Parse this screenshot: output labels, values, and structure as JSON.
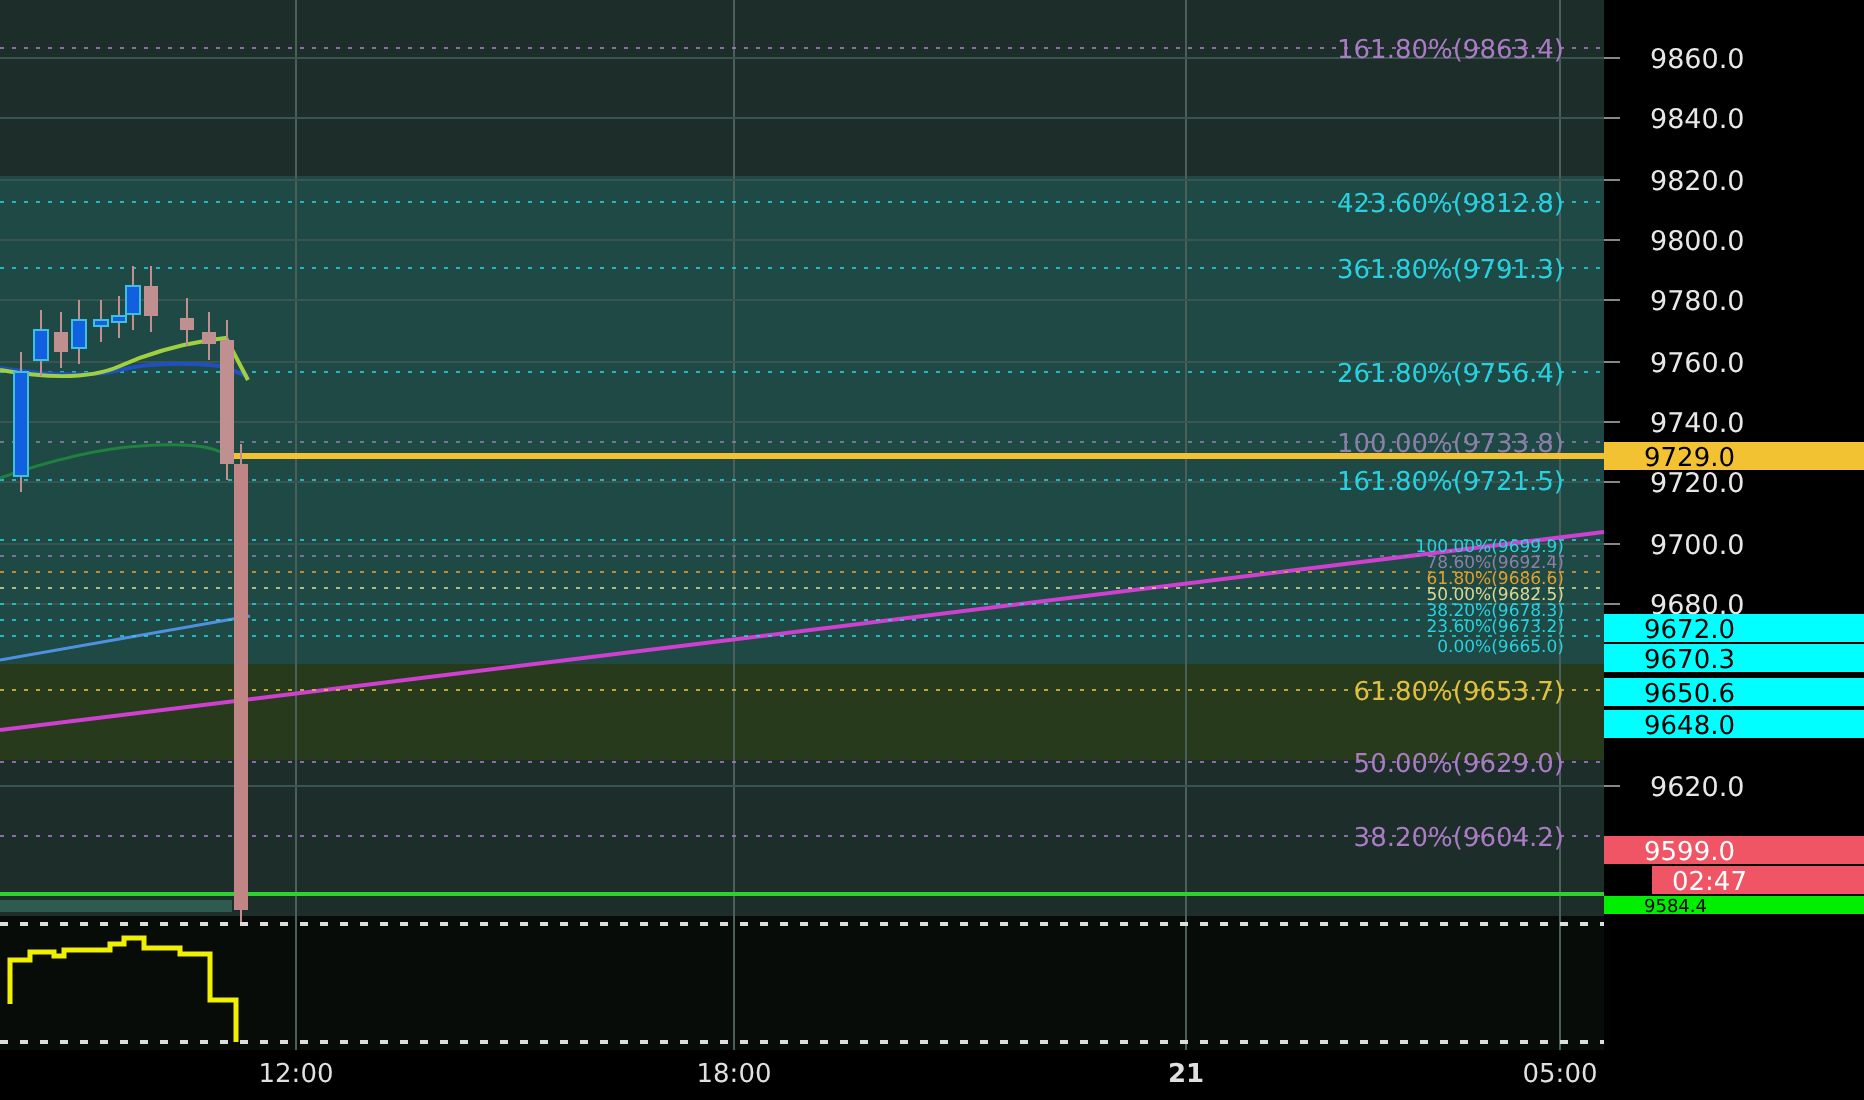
{
  "fib_levels": [
    {
      "label": "161.80%(9863.4)",
      "color": "#a97cc4"
    },
    {
      "label": "423.60%(9812.8)",
      "color": "#2ad0e0"
    },
    {
      "label": "361.80%(9791.3)",
      "color": "#2ad0e0"
    },
    {
      "label": "261.80%(9756.4)",
      "color": "#2ad0e0"
    },
    {
      "label": "100.00%(9733.8)",
      "color": "#8c80aa"
    },
    {
      "label": "161.80%(9721.5)",
      "color": "#2ad0e0"
    },
    {
      "label": "100.00%(9699.9)",
      "color": "#2ad0e0"
    },
    {
      "label": "78.60%(9692.4)",
      "color": "#8c80aa"
    },
    {
      "label": "61.80%(9686.6)",
      "color": "#e0a030"
    },
    {
      "label": "50.00%(9682.5)",
      "color": "#d8d890"
    },
    {
      "label": "38.20%(9678.3)",
      "color": "#2ad0e0"
    },
    {
      "label": "23.60%(9673.2)",
      "color": "#2ad0e0"
    },
    {
      "label": "0.00%(9665.0)",
      "color": "#2ad0e0"
    },
    {
      "label": "61.80%(9653.7)",
      "color": "#e0c040"
    },
    {
      "label": "50.00%(9629.0)",
      "color": "#a97cc4"
    },
    {
      "label": "38.20%(9604.2)",
      "color": "#a97cc4"
    }
  ],
  "price_axis": [
    "9860.0",
    "9840.0",
    "9820.0",
    "9800.0",
    "9780.0",
    "9760.0",
    "9740.0",
    "9720.0",
    "9700.0",
    "9680.0",
    "9620.0"
  ],
  "price_tags": [
    {
      "label": "9729.0",
      "color": "#f2c232"
    },
    {
      "label": "9672.0",
      "color": "#00ffff"
    },
    {
      "label": "9670.3",
      "color": "#00ffff"
    },
    {
      "label": "9650.6",
      "color": "#00ffff"
    },
    {
      "label": "9648.0",
      "color": "#00ffff"
    },
    {
      "label": "9599.0",
      "color": "#f05565"
    },
    {
      "label": "02:47",
      "color": "#f05565"
    },
    {
      "label": "9584.4",
      "color": "#00ee00"
    }
  ],
  "time_axis": [
    {
      "label": "12:00",
      "bold": false
    },
    {
      "label": "18:00",
      "bold": false
    },
    {
      "label": "21",
      "bold": true
    },
    {
      "label": "05:00",
      "bold": false
    }
  ]
}
